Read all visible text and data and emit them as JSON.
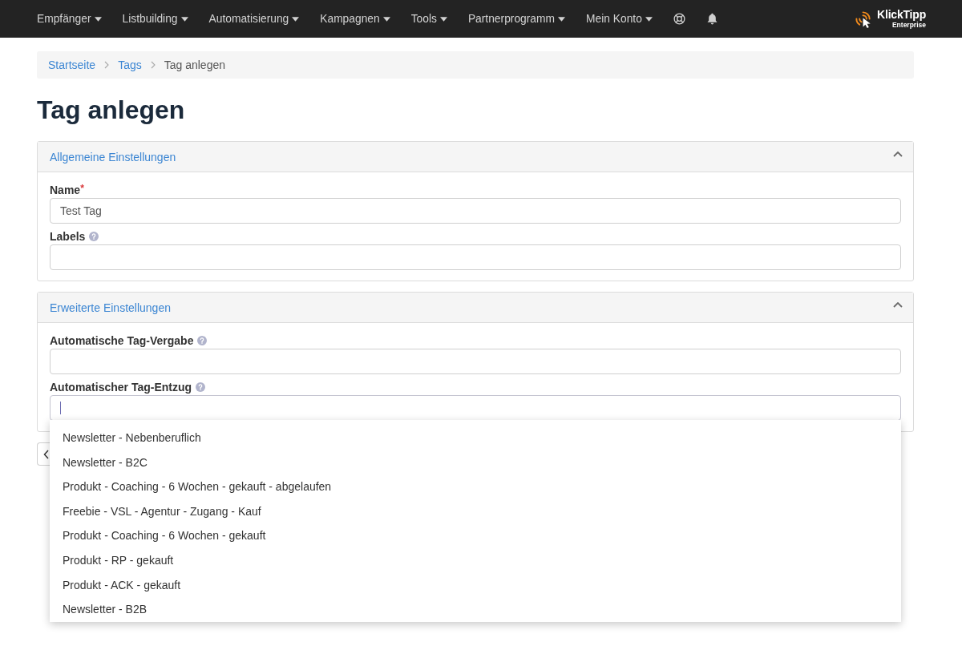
{
  "nav": {
    "items": [
      {
        "label": "Empfänger"
      },
      {
        "label": "Listbuilding"
      },
      {
        "label": "Automatisierung"
      },
      {
        "label": "Kampagnen"
      },
      {
        "label": "Tools"
      },
      {
        "label": "Partnerprogramm"
      },
      {
        "label": "Mein Konto"
      }
    ]
  },
  "brand": {
    "name": "KlickTipp",
    "edition": "Enterprise"
  },
  "breadcrumb": [
    {
      "label": "Startseite",
      "kind": "link"
    },
    {
      "label": "Tags",
      "kind": "link"
    },
    {
      "label": "Tag anlegen",
      "kind": "current"
    }
  ],
  "title": "Tag anlegen",
  "panels": [
    {
      "title": "Allgemeine Einstellungen",
      "expanded": true,
      "fields": [
        {
          "label": "Name",
          "required_mark": "*",
          "help": false,
          "focused": false,
          "value": "Test Tag"
        },
        {
          "label": "Labels",
          "help": true,
          "focused": false
        }
      ]
    },
    {
      "title": "Erweiterte Einstellungen",
      "expanded": true,
      "fields": [
        {
          "label": "Automatische Tag-Vergabe",
          "help": true,
          "focused": false
        },
        {
          "label": "Automatischer Tag-Entzug",
          "help": true,
          "focused": true,
          "suggestions": [
            "Newsletter - Nebenberuflich",
            "Newsletter - B2C",
            "Produkt - Coaching - 6 Wochen - gekauft - abgelaufen",
            "Freebie - VSL - Agentur - Zugang - Kauf",
            "Produkt - Coaching - 6 Wochen - gekauft",
            "Produkt - RP - gekauft",
            "Produkt - ACK - gekauft",
            "Newsletter - B2B"
          ]
        }
      ]
    }
  ]
}
